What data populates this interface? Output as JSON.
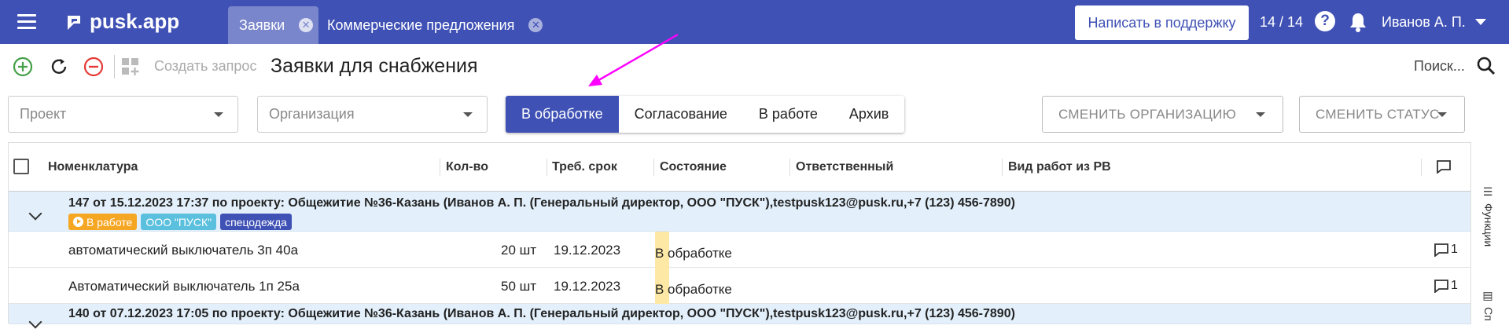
{
  "header": {
    "logo": "pusk.app",
    "tabs": [
      {
        "label": "Заявки",
        "active": true
      },
      {
        "label": "Коммерческие предложения",
        "active": false
      }
    ],
    "support_button": "Написать в поддержку",
    "counter": "14 / 14",
    "help_icon": "?",
    "user": "Иванов А. П."
  },
  "toolbar": {
    "create_label": "Создать запрос",
    "title": "Заявки для снабжения",
    "search_label": "Поиск..."
  },
  "filters": {
    "project_placeholder": "Проект",
    "organization_placeholder": "Организация",
    "status_tabs": [
      "В обработке",
      "Согласование",
      "В работе",
      "Архив"
    ],
    "active_status": "В обработке",
    "change_org": "СМЕНИТЬ ОРГАНИЗАЦИЮ",
    "change_status": "СМЕНИТЬ СТАТУС"
  },
  "table": {
    "columns": [
      "Номенклатура",
      "Кол-во",
      "Треб. срок",
      "Состояние",
      "Ответственный",
      "Вид работ из РВ"
    ],
    "groups": [
      {
        "title": "147 от 15.12.2023 17:37 по проекту: Общежитие №36-Казань (Иванов А. П. (Генеральный директор, ООО \"ПУСК\"),testpusk123@pusk.ru,+7 (123) 456-7890)",
        "badges": [
          "В работе",
          "ООО \"ПУСК\"",
          "спецодежда"
        ],
        "rows": [
          {
            "name": "автоматический выключатель 3п 40а",
            "qty": "20 шт",
            "date": "19.12.2023",
            "state": "В обработке",
            "comments": "1"
          },
          {
            "name": "Автоматический выключатель 1п 25а",
            "qty": "50 шт",
            "date": "19.12.2023",
            "state": "В обработке",
            "comments": "1"
          }
        ]
      },
      {
        "title": "140 от 07.12.2023 17:05 по проекту: Общежитие №36-Казань (Иванов А. П. (Генеральный директор, ООО \"ПУСК\"),testpusk123@pusk.ru,+7 (123) 456-7890)"
      }
    ]
  },
  "side_panel": {
    "functions": "Функции",
    "second": "Сп"
  },
  "colors": {
    "primary": "#3f51b5",
    "tab_active": "#7986cb",
    "badge_in_work": "#f5a623",
    "badge_org": "#5bc0de",
    "badge_category": "#3f51b5",
    "group_bg": "#e3f0fb",
    "state_marker": "#fde8a5",
    "annotation_arrow": "#ff00ff"
  }
}
